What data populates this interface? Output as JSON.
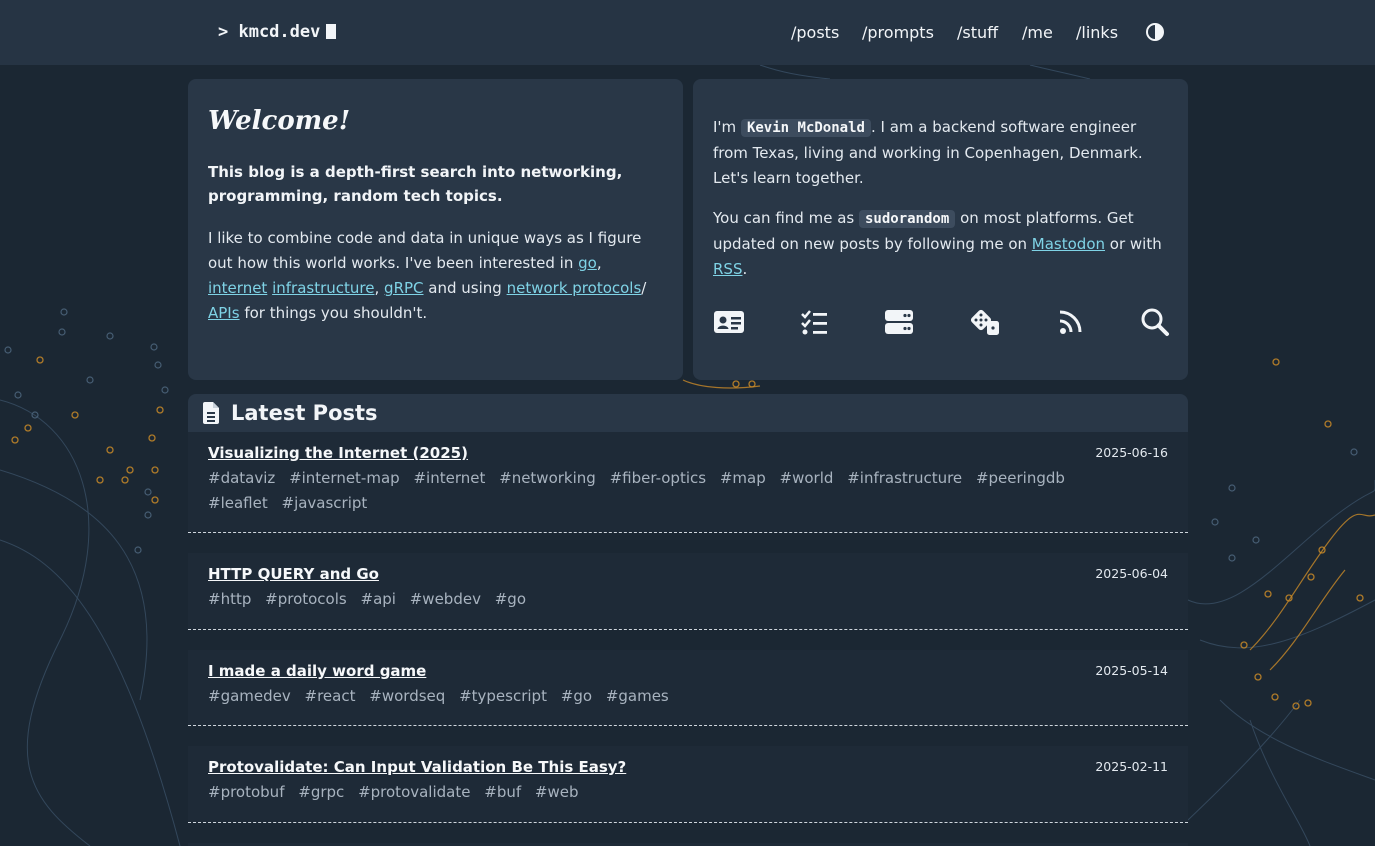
{
  "header": {
    "brand": "> kmcd.dev",
    "nav": [
      "/posts",
      "/prompts",
      "/stuff",
      "/me",
      "/links"
    ],
    "theme_toggle_icon": "contrast-icon"
  },
  "welcome": {
    "title": "Welcome!",
    "lead": "This blog is a depth-first search into networking, programming, random tech topics.",
    "p1": "I like to combine code and data in unique ways as I figure out how this world works. I've been interested in",
    "link_go": "go",
    "sep1": ",",
    "link_internet": "internet",
    "link_infrastructure": "infrastructure",
    "sep2": ",",
    "link_grpc": "gRPC",
    "and_using": "and using",
    "link_network_protocols": "network protocols",
    "slash": "/",
    "link_apis": "APIs",
    "tail": "for things you shouldn't."
  },
  "about": {
    "im": "I'm",
    "name": "Kevin McDonald",
    "desc": ". I am a backend software engineer from Texas, living and working in Copenhagen, Denmark. Let's learn together.",
    "find": "You can find me as",
    "handle": "sudorandom",
    "platforms": "on most platforms. Get updated on new posts by following me on",
    "link_mastodon": "Mastodon",
    "or_with": "or with",
    "link_rss": "RSS",
    "dot": ".",
    "icons": [
      "id-card-icon",
      "checklist-icon",
      "server-icon",
      "dice-icon",
      "rss-icon",
      "search-icon"
    ]
  },
  "posts": {
    "heading": "Latest Posts",
    "heading_icon": "document-icon",
    "items": [
      {
        "title": "Visualizing the Internet (2025)",
        "date": "2025-06-16",
        "tags": [
          "#dataviz",
          "#internet-map",
          "#internet",
          "#networking",
          "#fiber-optics",
          "#map",
          "#world",
          "#infrastructure",
          "#peeringdb",
          "#leaflet",
          "#javascript"
        ]
      },
      {
        "title": "HTTP QUERY and Go",
        "date": "2025-06-04",
        "tags": [
          "#http",
          "#protocols",
          "#api",
          "#webdev",
          "#go"
        ]
      },
      {
        "title": "I made a daily word game",
        "date": "2025-05-14",
        "tags": [
          "#gamedev",
          "#react",
          "#wordseq",
          "#typescript",
          "#go",
          "#games"
        ]
      },
      {
        "title": "Protovalidate: Can Input Validation Be This Easy?",
        "date": "2025-02-11",
        "tags": [
          "#protobuf",
          "#grpc",
          "#protovalidate",
          "#buf",
          "#web"
        ]
      }
    ]
  },
  "colors": {
    "background": "#1b2733",
    "card": "#293747",
    "link": "#7fd3e6",
    "map_accent": "#e0a030"
  }
}
